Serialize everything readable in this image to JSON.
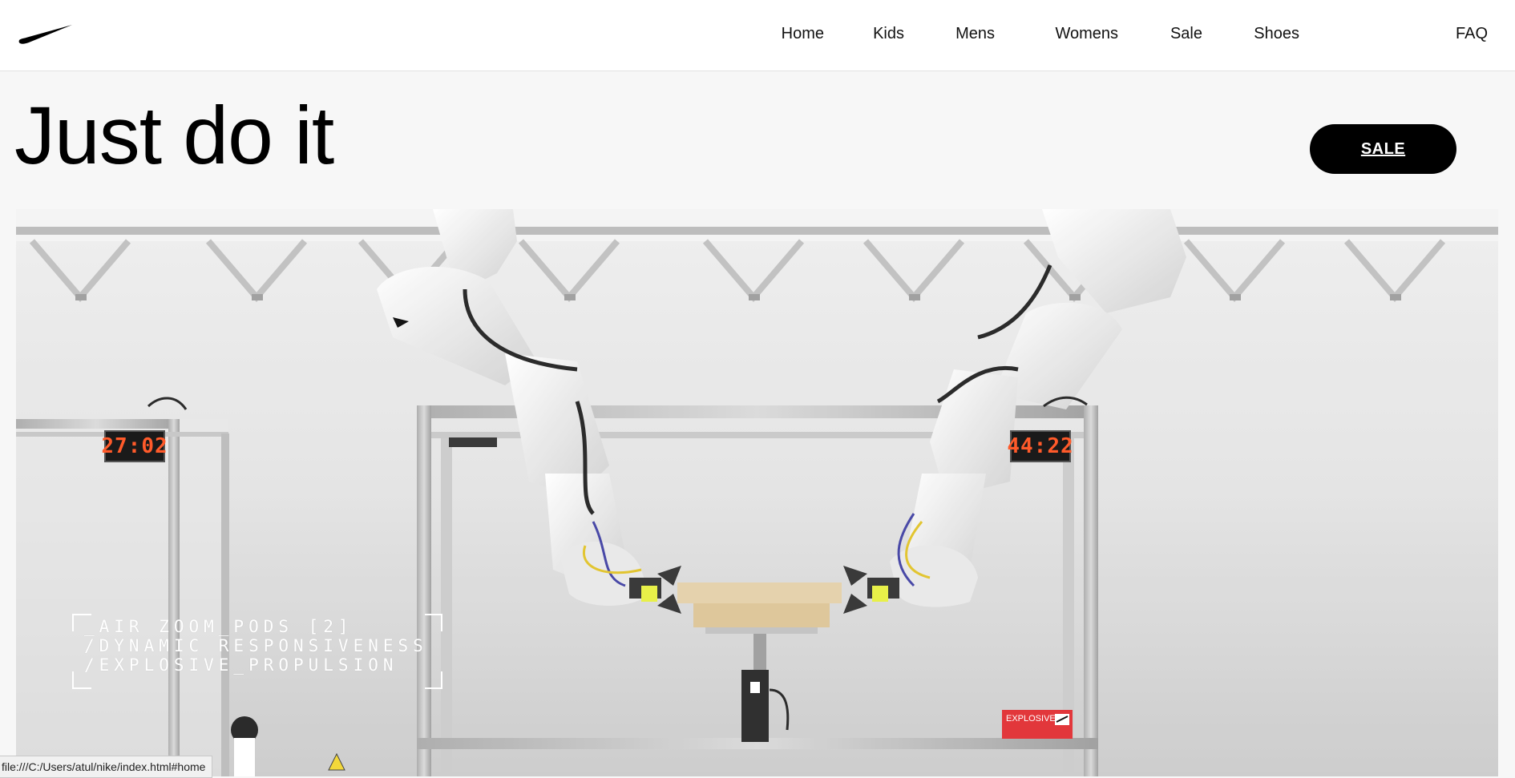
{
  "header": {
    "logo": "nike-swoosh-logo",
    "nav": [
      {
        "label": "Home"
      },
      {
        "label": "Kids"
      },
      {
        "label": "Mens"
      },
      {
        "label": "Womens"
      },
      {
        "label": "Sale"
      },
      {
        "label": "Shoes"
      },
      {
        "label": "FAQ"
      }
    ]
  },
  "hero": {
    "title": "Just do it",
    "sale_button": "SALE"
  },
  "video": {
    "overlay_lines": [
      "_AIR ZOOM_PODS [2]",
      "/DYNAMIC RESPONSIVENESS",
      "/EXPLOSIVE_PROPULSION"
    ],
    "clock_left": "27:02",
    "clock_right": "44:22",
    "label_tag": "EXPLOSIVE"
  },
  "status_bar": {
    "url": "file:///C:/Users/atul/nike/index.html#home"
  },
  "colors": {
    "accent": "#000000",
    "background": "#f7f7f7",
    "clock_digits": "#ff5a2a",
    "tag_red": "#e0262b"
  }
}
